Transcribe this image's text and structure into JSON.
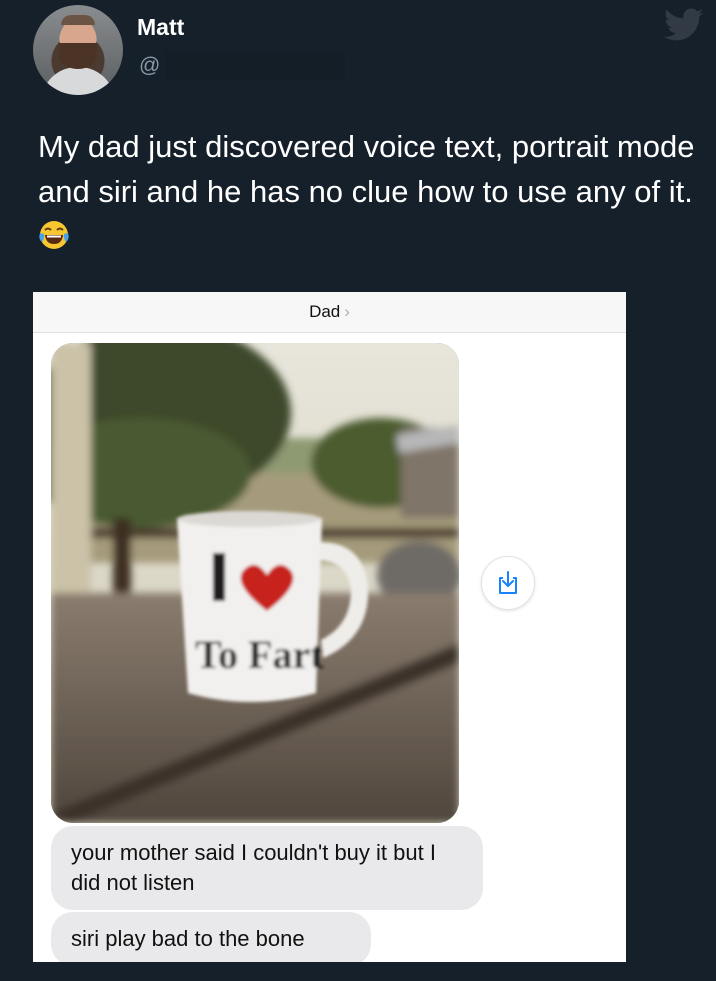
{
  "tweet": {
    "author_name": "Matt",
    "author_handle": "@",
    "text": "My dad just discovered voice text, portrait mode and siri and he has no clue how to use any of it.",
    "emoji": "face-with-tears-of-joy"
  },
  "screenshot": {
    "contact_name": "Dad",
    "contact_chevron": "›",
    "photo": {
      "mug_text_line1": "I",
      "mug_text_line2": "To Fart",
      "mug_heart": "heart-icon"
    },
    "save_icon": "save-download-icon",
    "messages": [
      {
        "text": "your mother said I couldn't buy it but I did not listen"
      },
      {
        "text": "siri play bad to the bone"
      }
    ]
  },
  "colors": {
    "background": "#15202b",
    "bubble": "#e9e9eb",
    "accent_blue": "#1a82fb",
    "handle_gray": "#8899a6"
  }
}
